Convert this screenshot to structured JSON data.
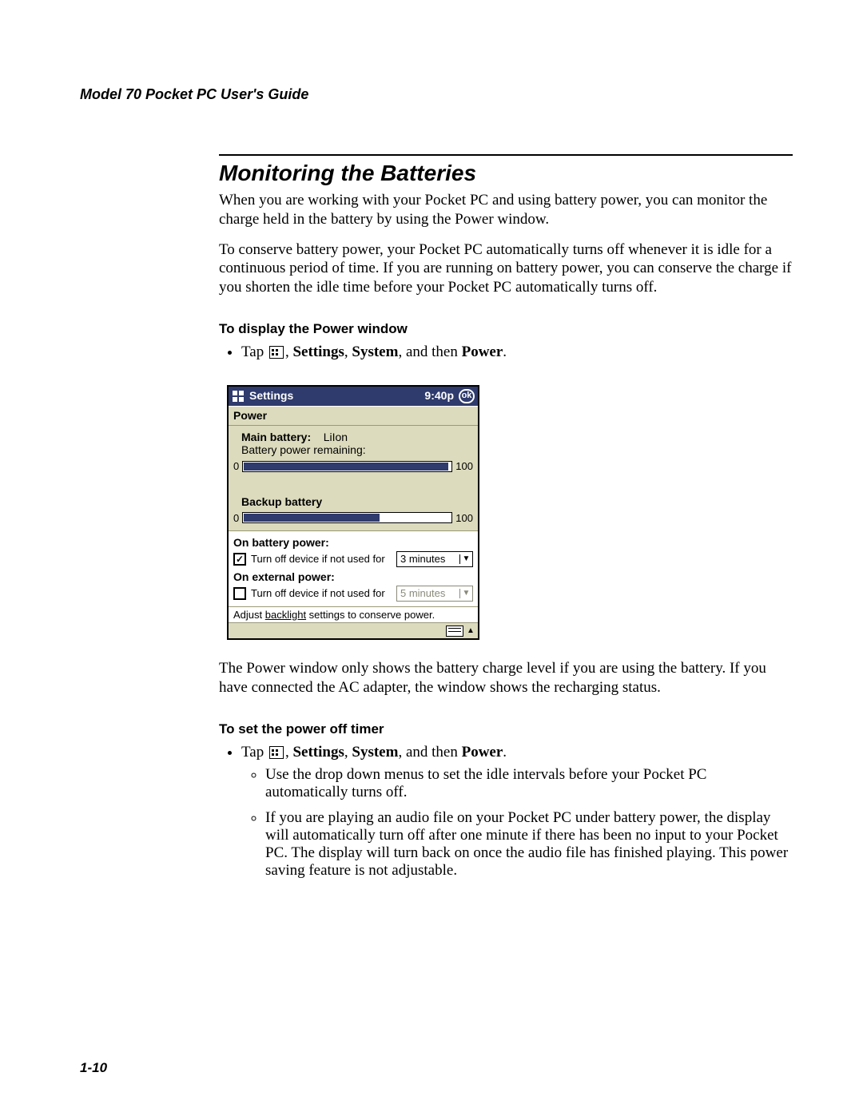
{
  "header": {
    "running_head": "Model 70 Pocket PC User's Guide"
  },
  "title": "Monitoring the Batteries",
  "para1": "When you are working with your Pocket PC and using battery power, you can monitor the charge held in the battery by using the Power window.",
  "para2": "To conserve battery power, your Pocket PC automatically turns off whenever it is idle for a continuous period of time. If you are running on battery power, you can conserve the charge if you shorten the idle time before your Pocket PC automatically turns off.",
  "sub1": "To display the Power window",
  "step1": {
    "prefix": "Tap ",
    "s1": "Settings",
    "s2": "System",
    "mid": ", and then ",
    "s3": "Power",
    "tail": "."
  },
  "pocket": {
    "titlebar": {
      "app": "Settings",
      "time": "9:40p",
      "ok": "ok"
    },
    "subbar": "Power",
    "main_label": "Main battery:",
    "main_type": "LiIon",
    "remaining_label": "Battery power remaining:",
    "scale_min": "0",
    "scale_max": "100",
    "main_fill_pct": 98,
    "backup_label": "Backup battery",
    "backup_fill_pct": 65,
    "battery_head": "On battery power:",
    "ext_head": "On external power:",
    "turnoff_text": "Turn off device if not used for",
    "battery_checked": true,
    "battery_value": "3 minutes",
    "ext_checked": false,
    "ext_value": "5 minutes",
    "hint_pre": "Adjust ",
    "hint_link": "backlight",
    "hint_post": " settings to conserve power."
  },
  "para3": "The Power window only shows the battery charge level if you are using the battery. If you have connected the AC adapter, the window shows the recharging status.",
  "sub2": "To set the power off timer",
  "step2a": "Use the drop down menus to set the idle intervals before your Pocket PC automatically turns off.",
  "step2b": "If you are playing an audio file on your Pocket PC under battery power, the display will automatically turn off after one minute if there has been no input to your Pocket PC. The display will turn back on once the audio file has finished playing. This power saving feature is not adjustable.",
  "page_number": "1-10"
}
